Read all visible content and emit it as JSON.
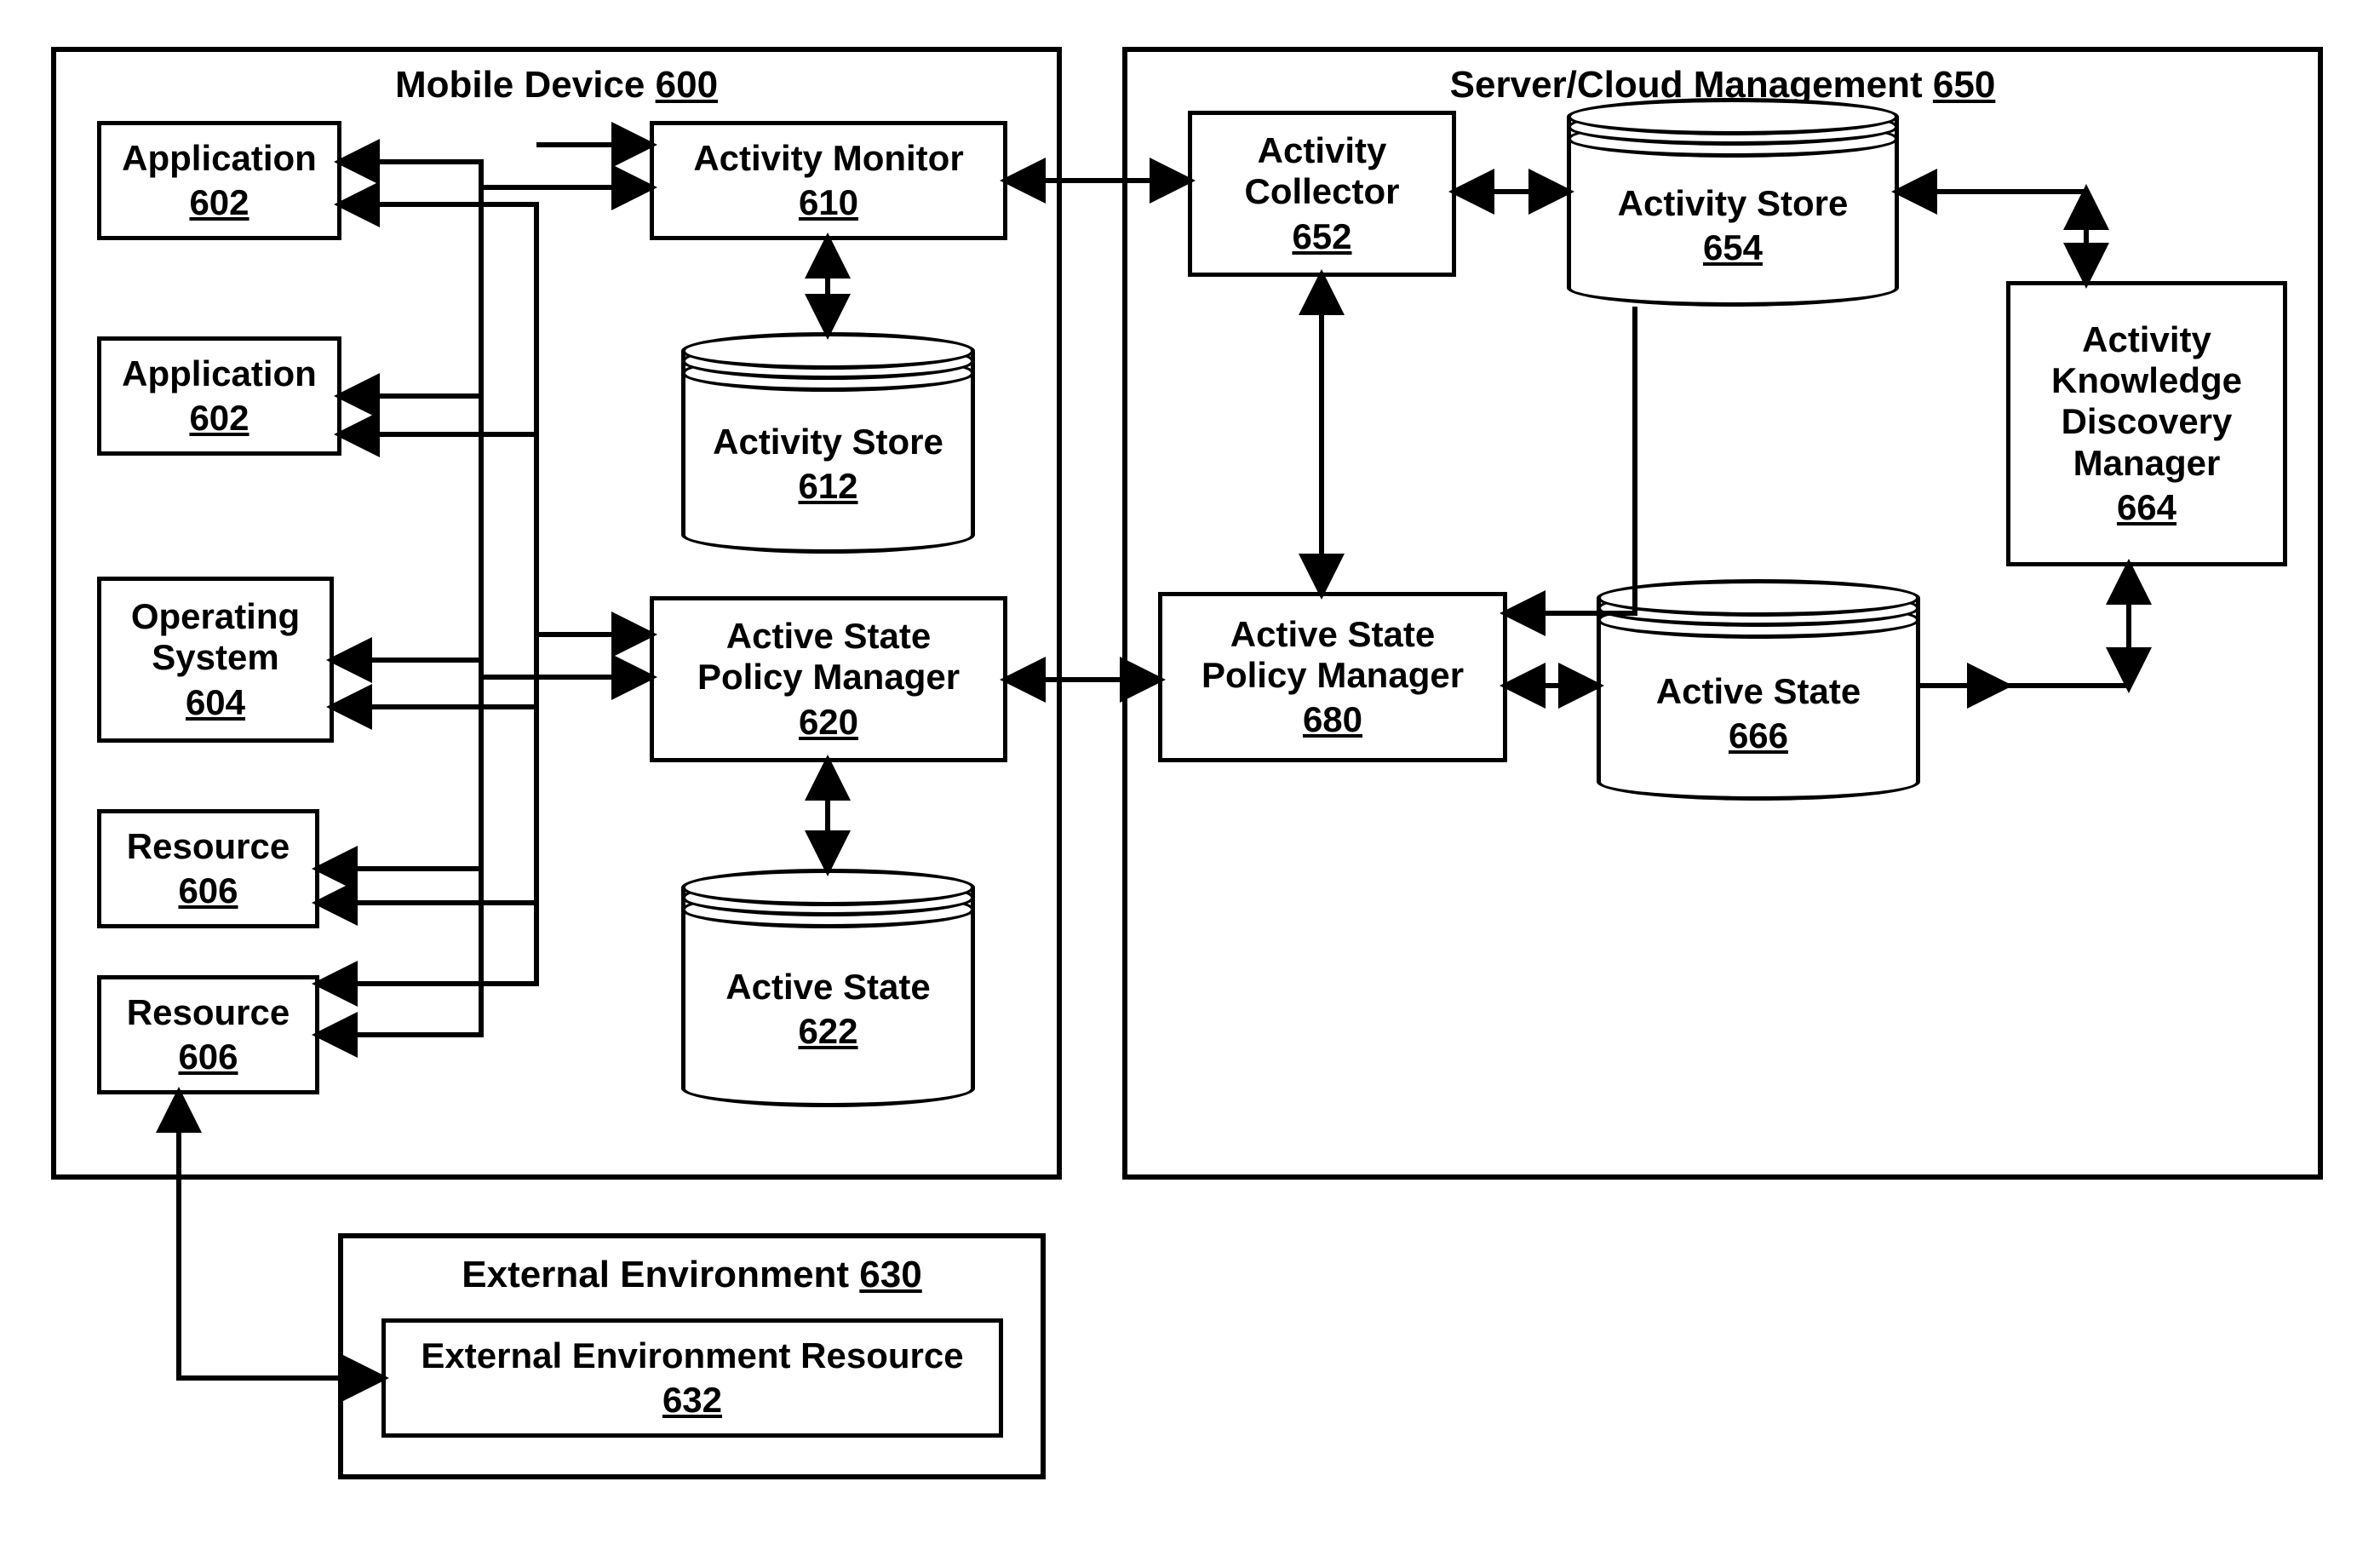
{
  "panels": {
    "mobile": {
      "label": "Mobile Device",
      "num": "600"
    },
    "server": {
      "label": "Server/Cloud Management",
      "num": "650"
    },
    "external": {
      "label": "External Environment",
      "num": "630"
    }
  },
  "boxes": {
    "app1": {
      "label": "Application",
      "num": "602"
    },
    "app2": {
      "label": "Application",
      "num": "602"
    },
    "os": {
      "label": "Operating\nSystem",
      "num": "604"
    },
    "res1": {
      "label": "Resource",
      "num": "606"
    },
    "res2": {
      "label": "Resource",
      "num": "606"
    },
    "actmon": {
      "label": "Activity Monitor",
      "num": "610"
    },
    "aspm_m": {
      "label": "Active State\nPolicy Manager",
      "num": "620"
    },
    "extres": {
      "label": "External Environment Resource",
      "num": "632"
    },
    "actcoll": {
      "label": "Activity\nCollector",
      "num": "652"
    },
    "akdm": {
      "label": "Activity\nKnowledge\nDiscovery\nManager",
      "num": "664"
    },
    "aspm_s": {
      "label": "Active State\nPolicy Manager",
      "num": "680"
    }
  },
  "cylinders": {
    "actstore_m": {
      "label": "Activity Store",
      "num": "612"
    },
    "activestate_m": {
      "label": "Active State",
      "num": "622"
    },
    "actstore_s": {
      "label": "Activity Store",
      "num": "654"
    },
    "activestate_s": {
      "label": "Active State",
      "num": "666"
    }
  },
  "chart_data": {
    "type": "graph",
    "nodes": [
      {
        "id": "600",
        "label": "Mobile Device",
        "kind": "panel"
      },
      {
        "id": "650",
        "label": "Server/Cloud Management",
        "kind": "panel"
      },
      {
        "id": "630",
        "label": "External Environment",
        "kind": "panel"
      },
      {
        "id": "602a",
        "label": "Application",
        "ref": "602",
        "parent": "600",
        "kind": "box"
      },
      {
        "id": "602b",
        "label": "Application",
        "ref": "602",
        "parent": "600",
        "kind": "box"
      },
      {
        "id": "604",
        "label": "Operating System",
        "parent": "600",
        "kind": "box"
      },
      {
        "id": "606a",
        "label": "Resource",
        "ref": "606",
        "parent": "600",
        "kind": "box"
      },
      {
        "id": "606b",
        "label": "Resource",
        "ref": "606",
        "parent": "600",
        "kind": "box"
      },
      {
        "id": "610",
        "label": "Activity Monitor",
        "parent": "600",
        "kind": "box"
      },
      {
        "id": "612",
        "label": "Activity Store",
        "parent": "600",
        "kind": "cylinder"
      },
      {
        "id": "620",
        "label": "Active State Policy Manager",
        "parent": "600",
        "kind": "box"
      },
      {
        "id": "622",
        "label": "Active State",
        "parent": "600",
        "kind": "cylinder"
      },
      {
        "id": "632",
        "label": "External Environment Resource",
        "parent": "630",
        "kind": "box"
      },
      {
        "id": "652",
        "label": "Activity Collector",
        "parent": "650",
        "kind": "box"
      },
      {
        "id": "654",
        "label": "Activity Store",
        "parent": "650",
        "kind": "cylinder"
      },
      {
        "id": "664",
        "label": "Activity Knowledge Discovery Manager",
        "parent": "650",
        "kind": "box"
      },
      {
        "id": "666",
        "label": "Active State",
        "parent": "650",
        "kind": "cylinder"
      },
      {
        "id": "680",
        "label": "Active State Policy Manager",
        "parent": "650",
        "kind": "box"
      }
    ],
    "edges": [
      {
        "from": "602a",
        "to": "610",
        "bidir": true
      },
      {
        "from": "602b",
        "to": "610",
        "bidir": true
      },
      {
        "from": "604",
        "to": "610",
        "bidir": true
      },
      {
        "from": "606a",
        "to": "610",
        "bidir": true
      },
      {
        "from": "606b",
        "to": "610",
        "bidir": true
      },
      {
        "from": "602a",
        "to": "620",
        "bidir": true
      },
      {
        "from": "602b",
        "to": "620",
        "bidir": true
      },
      {
        "from": "604",
        "to": "620",
        "bidir": true
      },
      {
        "from": "606a",
        "to": "620",
        "bidir": true
      },
      {
        "from": "606b",
        "to": "620",
        "bidir": true
      },
      {
        "from": "610",
        "to": "612",
        "bidir": true
      },
      {
        "from": "620",
        "to": "622",
        "bidir": true
      },
      {
        "from": "610",
        "to": "652",
        "bidir": true
      },
      {
        "from": "620",
        "to": "680",
        "bidir": true
      },
      {
        "from": "606b",
        "to": "632",
        "bidir": true
      },
      {
        "from": "652",
        "to": "654",
        "bidir": true
      },
      {
        "from": "652",
        "to": "680",
        "bidir": true
      },
      {
        "from": "654",
        "to": "680",
        "bidir": false
      },
      {
        "from": "654",
        "to": "664",
        "bidir": true
      },
      {
        "from": "680",
        "to": "666",
        "bidir": true
      },
      {
        "from": "666",
        "to": "664",
        "bidir": true
      }
    ]
  }
}
